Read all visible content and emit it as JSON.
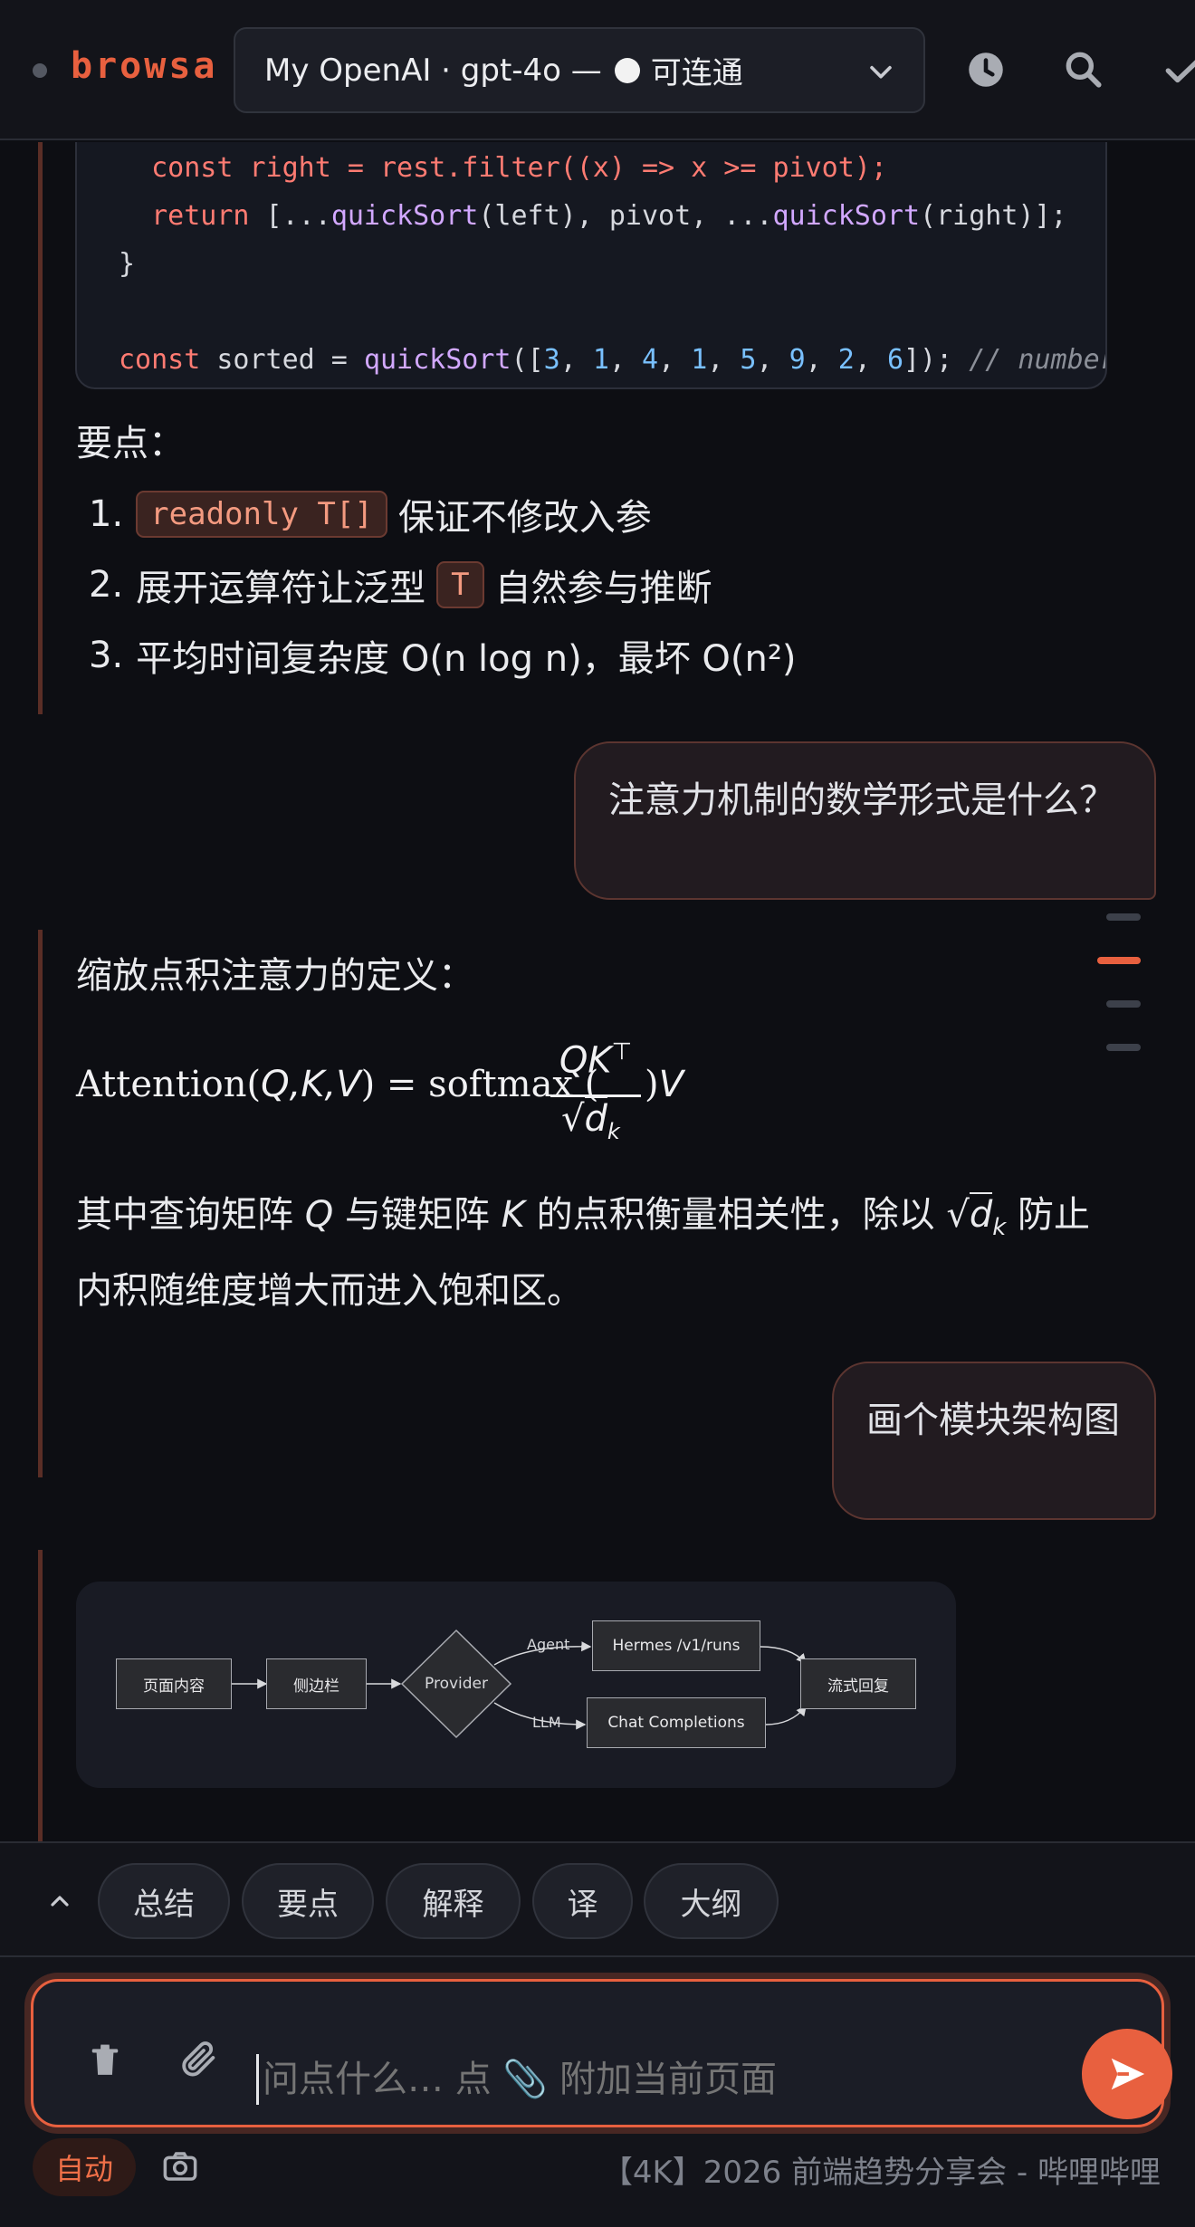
{
  "app": {
    "brand": "browsa",
    "provider_label": "My OpenAI · gpt-4o —",
    "provider_status": "可连通",
    "icons": [
      "history-icon",
      "search-icon",
      "check-icon"
    ]
  },
  "code": {
    "line1": "  const right = rest.filter((x) => x >= pivot);",
    "line2_return": "return",
    "line2_a": " [...",
    "line2_fn1": "quickSort",
    "line2_b": "(left), pivot, ...",
    "line2_fn2": "quickSort",
    "line2_c": "(right)];",
    "line3": "}",
    "line5_const": "const",
    "line5_a": " sorted = ",
    "line5_fn": "quickSort",
    "line5_b": "([",
    "line5_nums": [
      "3",
      "1",
      "4",
      "1",
      "5",
      "9",
      "2",
      "6"
    ],
    "line5_c": "]); ",
    "line5_comment": "// number[]"
  },
  "answer1": {
    "heading": "要点：",
    "items": [
      {
        "n": "1.",
        "code": "readonly T[]",
        "text": "保证不修改入参"
      },
      {
        "n": "2.",
        "pre": "展开运算符让泛型",
        "code": "T",
        "text": "自然参与推断"
      },
      {
        "n": "3.",
        "text": "平均时间复杂度 O(n log n)，最坏 O(n²)"
      }
    ]
  },
  "user1": "注意力机制的数学形式是什么？",
  "answer2": {
    "heading": "缩放点积注意力的定义：",
    "formula_lhs": "Attention(",
    "formula_vars": "Q,K,V",
    "formula_mid": ") = softmax (",
    "formula_num": "QK",
    "formula_sup": "⊤",
    "formula_den": "d",
    "formula_sub": "k",
    "formula_end": ")",
    "formula_v": "V",
    "para_a": "其中查询矩阵 ",
    "para_q": "Q",
    "para_b": " 与键矩阵 ",
    "para_k": "K",
    "para_c": " 的点积衡量相关性，除以 ",
    "para_d": "√",
    "para_dk": "d",
    "para_dk_sub": "k",
    "para_e": " 防止内积随维度增大而进入饱和区。"
  },
  "user2": "画个模块架构图",
  "diagram": {
    "nodes": [
      "页面内容",
      "侧边栏",
      "Provider",
      "Hermes /v1/runs",
      "Chat Completions",
      "流式回复"
    ],
    "edge_labels": [
      "Agent",
      "LLM"
    ]
  },
  "quick_actions": [
    "总结",
    "要点",
    "解释",
    "译",
    "大纲"
  ],
  "composer": {
    "placeholder": "问点什么… 点 📎 附加当前页面",
    "mode": "自动",
    "page_title": "【4K】2026 前端趋势分享会 - 哔哩哔哩"
  },
  "colors": {
    "accent": "#e8603f",
    "bg": "#0d0e13"
  }
}
